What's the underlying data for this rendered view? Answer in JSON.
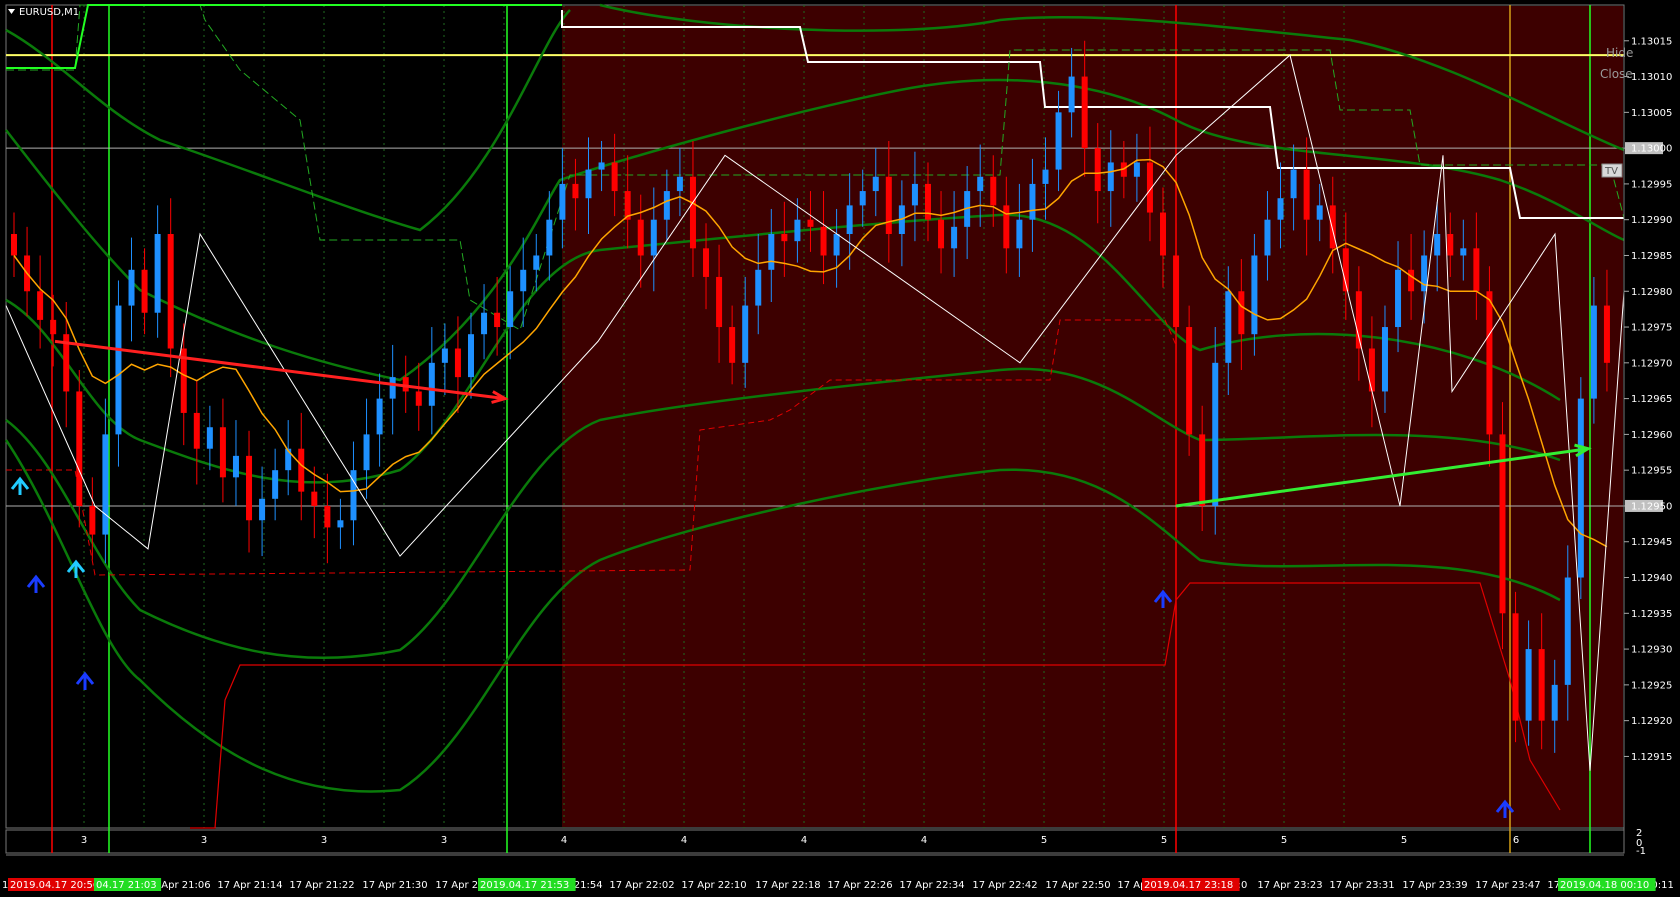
{
  "header": {
    "symbol_label": "EURUSD,M1"
  },
  "controls": {
    "hide_label": "Hide",
    "close_label": "Close",
    "tv_label": "TV"
  },
  "colors": {
    "background": "#000000",
    "shaded_region": "#3d0000",
    "bull_candle": "#1e90ff",
    "bear_candle": "#ff0000",
    "zigzag": "#ffffff",
    "moving_average": "#ffa500",
    "bands": "#0a7a0a",
    "bright_green": "#22ff22",
    "red_line": "#ff0000",
    "yellow_line": "#ffff66"
  },
  "chart_data": {
    "type": "candlestick",
    "symbol": "EURUSD",
    "timeframe": "M1",
    "y_axis": {
      "ylim": [
        1.12905,
        1.1302
      ],
      "ticks": [
        "1.13015",
        "1.13010",
        "1.13005",
        "1.13000",
        "1.12995",
        "1.12990",
        "1.12985",
        "1.12980",
        "1.12975",
        "1.12970",
        "1.12965",
        "1.12960",
        "1.12955",
        "1.12950",
        "1.12945",
        "1.12940",
        "1.12935",
        "1.12930",
        "1.12925",
        "1.12920",
        "1.12915"
      ],
      "highlighted_levels": [
        "1.13000",
        "1.12950"
      ]
    },
    "x_axis": {
      "ticks": [
        "17 Apr 21:06",
        "17 Apr 21:14",
        "17 Apr 21:22",
        "17 Apr 21:30",
        "17 Apr 21:38",
        "17 Apr 21:54",
        "17 Apr 22:02",
        "17 Apr 22:10",
        "17 Apr 22:18",
        "17 Apr 22:26",
        "17 Apr 22:34",
        "17 Apr 22:42",
        "17 Apr 22:50",
        "17 Apr 22:58",
        "17 Apr 23:0",
        "17 Apr 23:23",
        "17 Apr 23:31",
        "17 Apr 23:39",
        "17 Apr 23:47",
        "17 Apr 23:55"
      ],
      "left_fragment": "17",
      "right_fragment": "00:11",
      "highlighted_times": [
        {
          "label": "2019.04.17 20:56",
          "bg": "#e00000"
        },
        {
          "label": "04.17 21:03",
          "bg": "#22dd22"
        },
        {
          "label": "2019.04.17 21:53",
          "bg": "#22dd22"
        },
        {
          "label": "2019.04.17 23:18",
          "bg": "#e00000"
        },
        {
          "label": "2019.04.18 00:10",
          "bg": "#22dd22"
        }
      ]
    },
    "count_labels": [
      "3",
      "3",
      "3",
      "3",
      "4",
      "4",
      "4",
      "4",
      "5",
      "5",
      "5",
      "5",
      "6"
    ],
    "sub_window_axis": [
      "2",
      "0",
      "-1"
    ],
    "horizontal_levels": [
      {
        "price": 1.13013,
        "color": "#ffff66",
        "name": "yellow level"
      },
      {
        "price": 1.13,
        "color": "#b0b0b0",
        "name": "grey level"
      },
      {
        "price": 1.1295,
        "color": "#b0b0b0",
        "name": "grey level 2"
      }
    ],
    "trend_arrows": [
      {
        "from": [
          1.12973,
          "20:56"
        ],
        "to": [
          1.12965,
          "21:53"
        ],
        "color": "#ff2020"
      },
      {
        "from": [
          1.1295,
          "23:18"
        ],
        "to": [
          1.12958,
          "00:10"
        ],
        "color": "#33ee33"
      }
    ],
    "zigzag_prices": [
      1.12978,
      1.1295,
      1.12944,
      1.12988,
      1.12943,
      1.12973,
      1.12999,
      1.1297,
      1.12999,
      1.13013,
      1.1295,
      1.12999,
      1.12966,
      1.12988,
      1.12913,
      1.1298
    ],
    "candles_close": [
      1.12985,
      1.1298,
      1.12976,
      1.12974,
      1.12966,
      1.1295,
      1.12946,
      1.1296,
      1.12978,
      1.12983,
      1.12977,
      1.12988,
      1.12972,
      1.12963,
      1.12958,
      1.12961,
      1.12954,
      1.12957,
      1.12948,
      1.12951,
      1.12955,
      1.12958,
      1.12952,
      1.1295,
      1.12947,
      1.12948,
      1.12955,
      1.1296,
      1.12965,
      1.12968,
      1.12966,
      1.12964,
      1.1297,
      1.12972,
      1.12968,
      1.12974,
      1.12977,
      1.12975,
      1.1298,
      1.12983,
      1.12985,
      1.1299,
      1.12995,
      1.12993,
      1.12997,
      1.12998,
      1.12994,
      1.1299,
      1.12985,
      1.1299,
      1.12994,
      1.12996,
      1.12986,
      1.12982,
      1.12975,
      1.1297,
      1.12978,
      1.12983,
      1.12988,
      1.12987,
      1.1299,
      1.12989,
      1.12985,
      1.12988,
      1.12992,
      1.12994,
      1.12996,
      1.12988,
      1.12992,
      1.12995,
      1.1299,
      1.12986,
      1.12989,
      1.12994,
      1.12996,
      1.12992,
      1.12986,
      1.1299,
      1.12995,
      1.12997,
      1.13005,
      1.1301,
      1.13,
      1.12994,
      1.12998,
      1.12996,
      1.12998,
      1.12991,
      1.12985,
      1.12975,
      1.1296,
      1.1295,
      1.1297,
      1.1298,
      1.12974,
      1.12985,
      1.1299,
      1.12993,
      1.12997,
      1.1299,
      1.12992,
      1.12986,
      1.1298,
      1.12972,
      1.12966,
      1.12975,
      1.12983,
      1.1298,
      1.12985,
      1.12988,
      1.12985,
      1.12986,
      1.1298,
      1.1296,
      1.12935,
      1.1292,
      1.1293,
      1.1292,
      1.12925,
      1.1294,
      1.12965,
      1.12978,
      1.1297
    ]
  }
}
